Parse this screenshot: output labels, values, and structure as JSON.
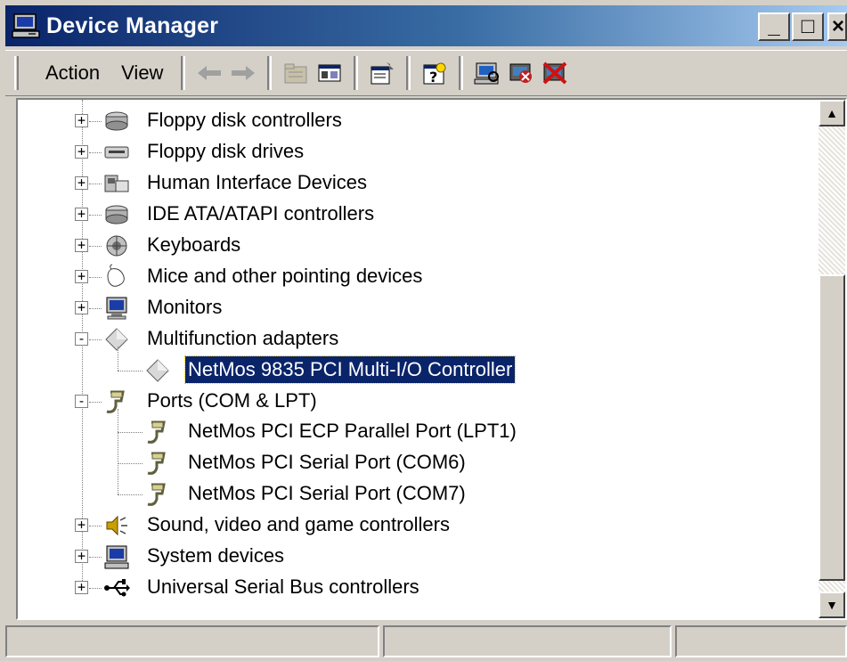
{
  "window": {
    "title": "Device Manager",
    "title_icon": "computer-icon",
    "buttons": {
      "minimize": "_",
      "maximize": "□",
      "close": "×"
    }
  },
  "toolbar": {
    "menus": [
      "Action",
      "View"
    ],
    "tools": [
      "back-icon",
      "forward-icon",
      "up-folder-icon",
      "show-hide-tree-icon",
      "properties-icon",
      "help-icon",
      "scan-hardware-icon",
      "update-driver-icon",
      "uninstall-icon"
    ]
  },
  "tree": {
    "nodes": [
      {
        "label": "Floppy disk controllers",
        "expander": "+",
        "icon": "disk-controller-icon",
        "level": 0
      },
      {
        "label": "Floppy disk drives",
        "expander": "+",
        "icon": "floppy-drive-icon",
        "level": 0
      },
      {
        "label": "Human Interface Devices",
        "expander": "+",
        "icon": "hid-icon",
        "level": 0
      },
      {
        "label": "IDE ATA/ATAPI controllers",
        "expander": "+",
        "icon": "ide-controller-icon",
        "level": 0
      },
      {
        "label": "Keyboards",
        "expander": "+",
        "icon": "keyboard-icon",
        "level": 0
      },
      {
        "label": "Mice and other pointing devices",
        "expander": "+",
        "icon": "mouse-icon",
        "level": 0
      },
      {
        "label": "Monitors",
        "expander": "+",
        "icon": "monitor-icon",
        "level": 0
      },
      {
        "label": "Multifunction adapters",
        "expander": "-",
        "icon": "multifunction-icon",
        "level": 0
      },
      {
        "label": "NetMos 9835 PCI Multi-I/O Controller",
        "expander": "",
        "icon": "multifunction-icon",
        "level": 1,
        "selected": true
      },
      {
        "label": "Ports (COM & LPT)",
        "expander": "-",
        "icon": "port-icon",
        "level": 0
      },
      {
        "label": "NetMos PCI ECP Parallel Port (LPT1)",
        "expander": "",
        "icon": "port-icon",
        "level": 1
      },
      {
        "label": "NetMos PCI Serial Port (COM6)",
        "expander": "",
        "icon": "port-icon",
        "level": 1
      },
      {
        "label": "NetMos PCI Serial Port (COM7)",
        "expander": "",
        "icon": "port-icon",
        "level": 1
      },
      {
        "label": "Sound, video and game controllers",
        "expander": "+",
        "icon": "sound-icon",
        "level": 0
      },
      {
        "label": "System devices",
        "expander": "+",
        "icon": "system-device-icon",
        "level": 0
      },
      {
        "label": "Universal Serial Bus controllers",
        "expander": "+",
        "icon": "usb-icon",
        "level": 0
      }
    ]
  },
  "scrollbar": {
    "up": "▲",
    "down": "▼"
  },
  "statusbar": {
    "panes": [
      "",
      "",
      ""
    ]
  },
  "colors": {
    "face": "#d4d0c8",
    "title_start": "#0a246a",
    "title_end": "#a6caf0",
    "selection": "#0a246a"
  }
}
